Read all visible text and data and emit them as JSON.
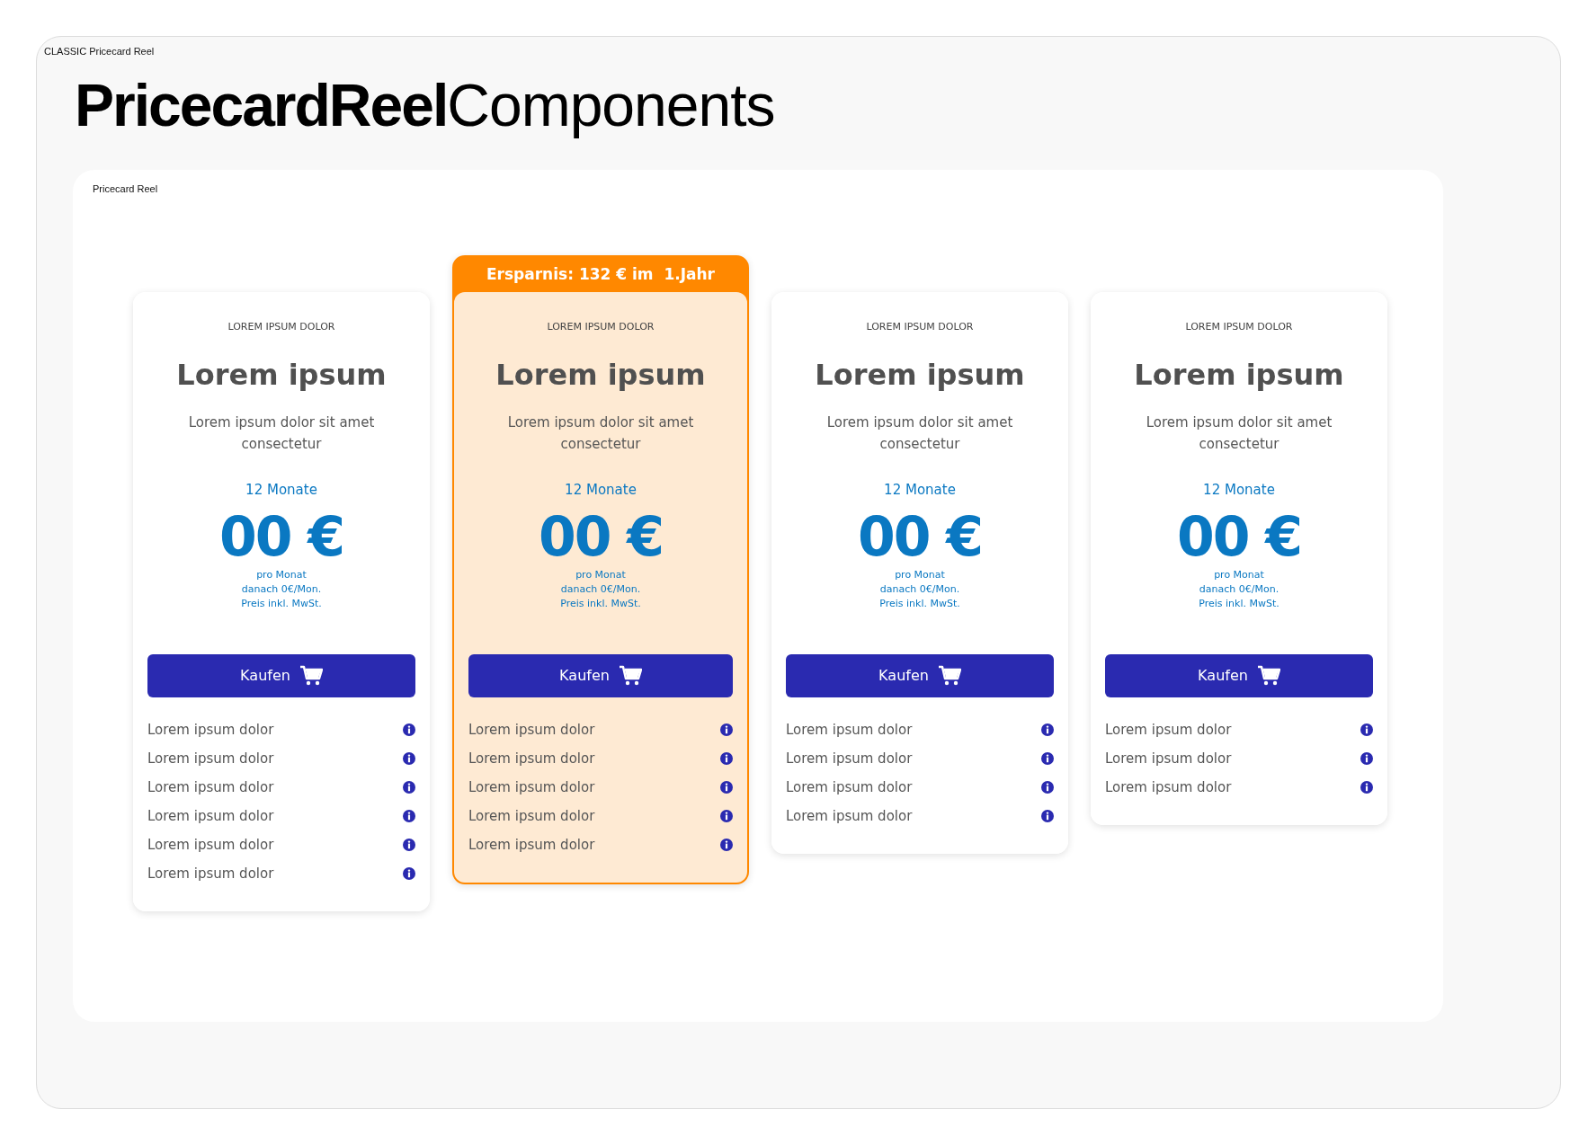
{
  "frame_label": "CLASSIC Pricecard Reel",
  "title": {
    "bold": "PricecardReel",
    "light": "Components"
  },
  "panel_label": "Pricecard Reel",
  "cards": [
    {
      "highlighted": false,
      "eyebrow": "LOREM IPSUM DOLOR",
      "heading": "Lorem ipsum",
      "description": "Lorem ipsum dolor sit amet consectetur",
      "duration": "12 Monate",
      "price": "00 €",
      "notes": [
        "pro Monat",
        "danach 0€/Mon.",
        "Preis inkl. MwSt."
      ],
      "button": "Kaufen",
      "features": [
        "Lorem ipsum dolor",
        "Lorem ipsum dolor",
        "Lorem ipsum dolor",
        "Lorem ipsum dolor",
        "Lorem ipsum dolor",
        "Lorem ipsum dolor"
      ]
    },
    {
      "highlighted": true,
      "badge": "Ersparnis: 132 € im  1.Jahr",
      "eyebrow": "LOREM IPSUM DOLOR",
      "heading": "Lorem ipsum",
      "description": "Lorem ipsum dolor sit amet consectetur",
      "duration": "12 Monate",
      "price": "00 €",
      "notes": [
        "pro Monat",
        "danach 0€/Mon.",
        "Preis inkl. MwSt."
      ],
      "button": "Kaufen",
      "features": [
        "Lorem ipsum dolor",
        "Lorem ipsum dolor",
        "Lorem ipsum dolor",
        "Lorem ipsum dolor",
        "Lorem ipsum dolor"
      ]
    },
    {
      "highlighted": false,
      "eyebrow": "LOREM IPSUM DOLOR",
      "heading": "Lorem ipsum",
      "description": "Lorem ipsum dolor sit amet consectetur",
      "duration": "12 Monate",
      "price": "00 €",
      "notes": [
        "pro Monat",
        "danach 0€/Mon.",
        "Preis inkl. MwSt."
      ],
      "button": "Kaufen",
      "features": [
        "Lorem ipsum dolor",
        "Lorem ipsum dolor",
        "Lorem ipsum dolor",
        "Lorem ipsum dolor"
      ]
    },
    {
      "highlighted": false,
      "eyebrow": "LOREM IPSUM DOLOR",
      "heading": "Lorem ipsum",
      "description": "Lorem ipsum dolor sit amet consectetur",
      "duration": "12 Monate",
      "price": "00 €",
      "notes": [
        "pro Monat",
        "danach 0€/Mon.",
        "Preis inkl. MwSt."
      ],
      "button": "Kaufen",
      "features": [
        "Lorem ipsum dolor",
        "Lorem ipsum dolor",
        "Lorem ipsum dolor"
      ]
    }
  ]
}
